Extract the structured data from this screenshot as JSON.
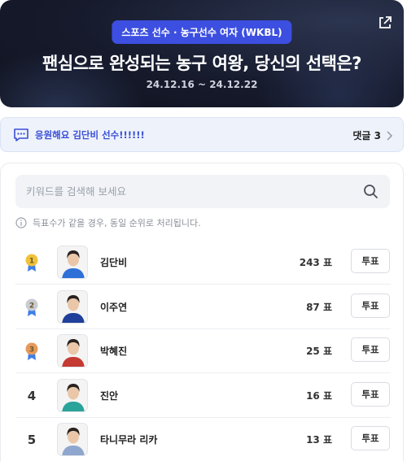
{
  "hero": {
    "category": "스포츠 선수 · 농구선수 여자 (WKBL)",
    "title": "팬심으로 완성되는 농구 여왕, 당신의 선택은?",
    "period": "24.12.16 ~ 24.12.22",
    "share_icon": "share-external-icon"
  },
  "cheer": {
    "text": "응원해요 김단비 선수!!!!!!",
    "comment_label": "댓글 3"
  },
  "search": {
    "placeholder": "키워드를 검색해 보세요"
  },
  "notice": "득표수가 같을 경우, 동일 순위로 처리됩니다.",
  "ranking": [
    {
      "rank": "1",
      "medal": "gold",
      "name": "김단비",
      "votes": "243 표",
      "button": "투표",
      "jersey_color": "#2f6fd8"
    },
    {
      "rank": "2",
      "medal": "silver",
      "name": "이주연",
      "votes": "87 표",
      "button": "투표",
      "jersey_color": "#1f3f9a"
    },
    {
      "rank": "3",
      "medal": "bronze",
      "name": "박혜진",
      "votes": "25 표",
      "button": "투표",
      "jersey_color": "#c53a32"
    },
    {
      "rank": "4",
      "medal": "",
      "name": "진안",
      "votes": "16 표",
      "button": "투표",
      "jersey_color": "#2aa39a"
    },
    {
      "rank": "5",
      "medal": "",
      "name": "타니무라 리카",
      "votes": "13 표",
      "button": "투표",
      "jersey_color": "#8fa7cf"
    }
  ],
  "colors": {
    "accent": "#3c4fe0",
    "gold": "#f0c23a",
    "silver": "#c9ccd3",
    "bronze": "#e59a5c",
    "ribbon": "#3f7ee8"
  }
}
